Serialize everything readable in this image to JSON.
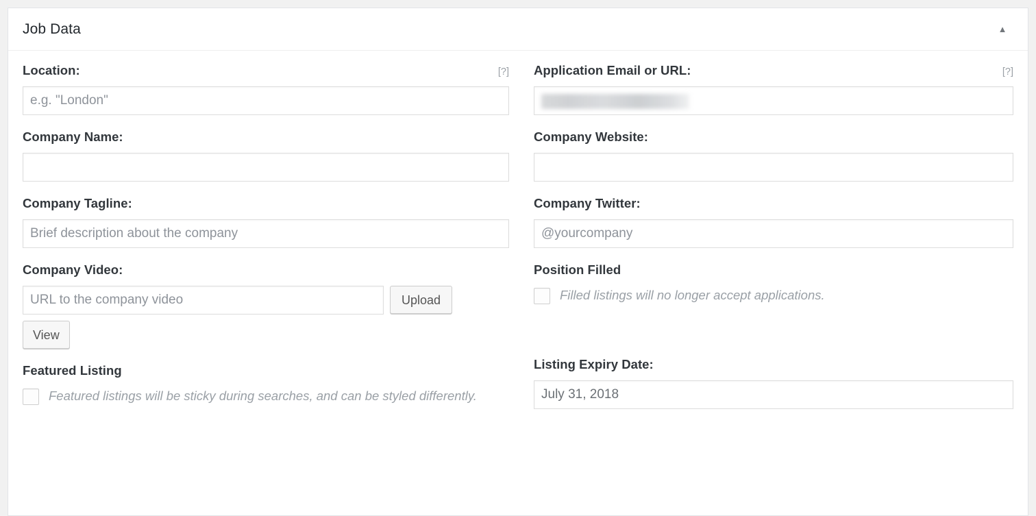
{
  "panel": {
    "title": "Job Data",
    "toggle_icon": "triangle-up-icon",
    "toggle_glyph": "▲"
  },
  "fields": {
    "location": {
      "label": "Location:",
      "help": "[?]",
      "placeholder": "e.g. \"London\"",
      "value": ""
    },
    "application": {
      "label": "Application Email or URL:",
      "help": "[?]",
      "placeholder": "",
      "value": "",
      "redacted": true
    },
    "company_name": {
      "label": "Company Name:",
      "placeholder": "",
      "value": ""
    },
    "company_website": {
      "label": "Company Website:",
      "placeholder": "",
      "value": ""
    },
    "company_tagline": {
      "label": "Company Tagline:",
      "placeholder": "Brief description about the company",
      "value": ""
    },
    "company_twitter": {
      "label": "Company Twitter:",
      "placeholder": "@yourcompany",
      "value": ""
    },
    "company_video": {
      "label": "Company Video:",
      "placeholder": "URL to the company video",
      "value": "",
      "upload_label": "Upload",
      "view_label": "View"
    },
    "position_filled": {
      "label": "Position Filled",
      "description": "Filled listings will no longer accept applications.",
      "checked": false
    },
    "featured_listing": {
      "label": "Featured Listing",
      "description": "Featured listings will be sticky during searches, and can be styled differently.",
      "checked": false
    },
    "listing_expiry": {
      "label": "Listing Expiry Date:",
      "placeholder": "",
      "value": "July 31, 2018"
    }
  },
  "colors": {
    "page_background": "#f1f1f1",
    "panel_background": "#ffffff",
    "panel_border": "#e2e4e7",
    "label_text": "#32373c",
    "placeholder_text": "#8e939a",
    "muted_text": "#9aa0a6",
    "input_border": "#dddddd",
    "button_face": "#f7f7f7",
    "button_border": "#cccccc"
  }
}
